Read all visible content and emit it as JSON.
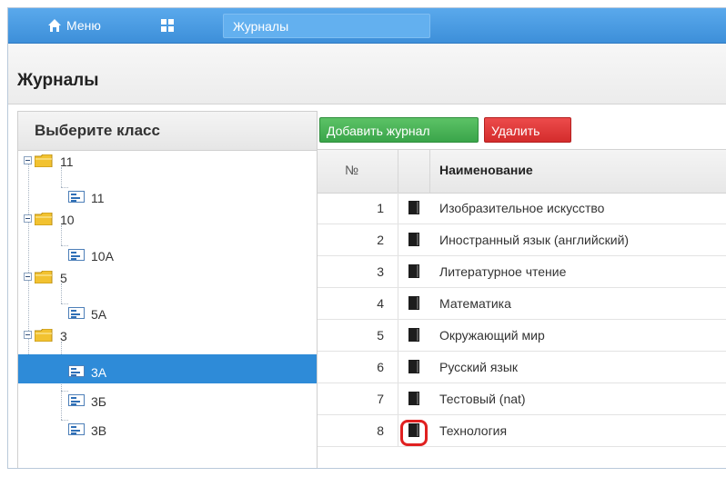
{
  "nav": {
    "menu_label": "Меню",
    "breadcrumb": "Журналы",
    "icons": [
      "home-icon",
      "grid-icon"
    ]
  },
  "page": {
    "title": "Журналы"
  },
  "left_panel": {
    "header": "Выберите класс",
    "tree": [
      {
        "type": "folder",
        "label": "11"
      },
      {
        "type": "leaf",
        "label": "11"
      },
      {
        "type": "folder",
        "label": "10"
      },
      {
        "type": "leaf",
        "label": "10А"
      },
      {
        "type": "folder",
        "label": "5"
      },
      {
        "type": "leaf",
        "label": "5А"
      },
      {
        "type": "folder",
        "label": "3"
      },
      {
        "type": "leaf",
        "label": "3А",
        "selected": true
      },
      {
        "type": "leaf",
        "label": "3Б"
      },
      {
        "type": "leaf",
        "label": "3В"
      }
    ]
  },
  "toolbar": {
    "add_label": "Добавить журнал",
    "delete_label": "Удалить"
  },
  "table": {
    "headers": {
      "num": "№",
      "name": "Наименование"
    },
    "rows": [
      {
        "num": "1",
        "name": "Изобразительное искусство"
      },
      {
        "num": "2",
        "name": "Иностранный язык (английский)"
      },
      {
        "num": "3",
        "name": "Литературное чтение"
      },
      {
        "num": "4",
        "name": "Математика"
      },
      {
        "num": "5",
        "name": "Окружающий мир"
      },
      {
        "num": "6",
        "name": "Русский язык"
      },
      {
        "num": "7",
        "name": "Тестовый (nat)"
      },
      {
        "num": "8",
        "name": "Технология",
        "highlighted": true
      }
    ]
  },
  "colors": {
    "topbar": "#3d8fd9",
    "selected": "#2e8bd8",
    "add_button": "#3aa54a",
    "delete_button": "#d42c2c",
    "highlight": "#e02020"
  }
}
